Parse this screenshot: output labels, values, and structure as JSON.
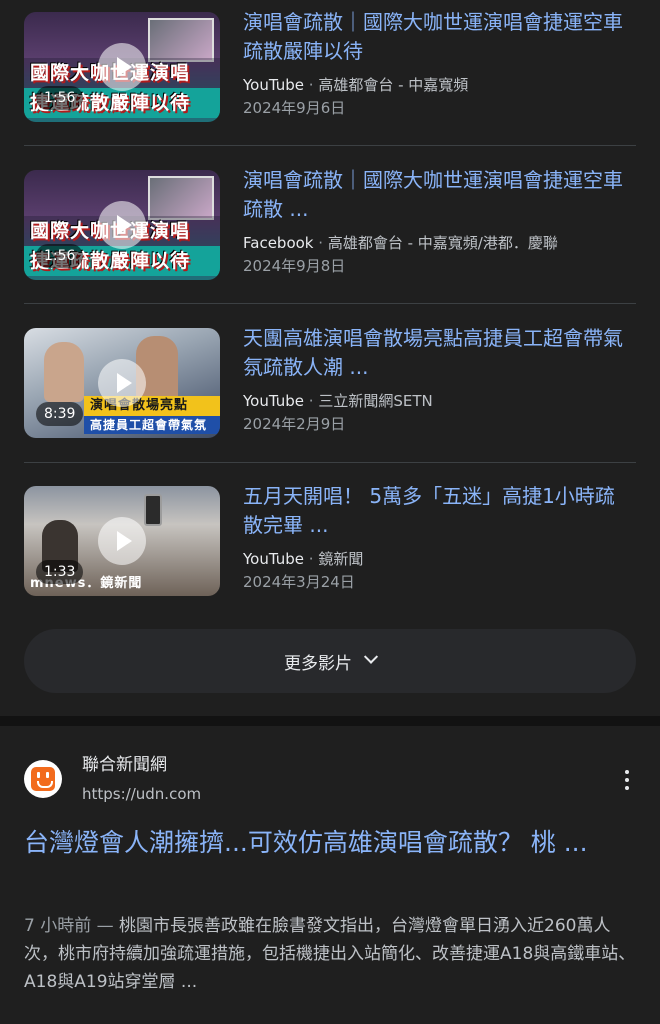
{
  "videos": [
    {
      "title": "演唱會疏散｜國際大咖世運演唱會捷運空車疏散嚴陣以待",
      "platform": "YouTube",
      "source": "高雄都會台 - 中嘉寬頻",
      "date": "2024年9月6日",
      "duration": "1:56",
      "thumb_text_1": "國際大咖世運演唱",
      "thumb_text_2": "捷運疏散嚴陣以待"
    },
    {
      "title": "演唱會疏散｜國際大咖世運演唱會捷運空車疏散 ...",
      "platform": "Facebook",
      "source": "高雄都會台 - 中嘉寬頻/港都．慶聯",
      "date": "2024年9月8日",
      "duration": "1:56",
      "thumb_text_1": "國際大咖世運演唱",
      "thumb_text_2": "捷運疏散嚴陣以待"
    },
    {
      "title": "天團高雄演唱會散場亮點高捷員工超會帶氣氛疏散人潮 ...",
      "platform": "YouTube",
      "source": "三立新聞網SETN",
      "date": "2024年2月9日",
      "duration": "8:39",
      "thumb_text_1": "演唱會散場亮點",
      "thumb_text_2": "高捷員工超會帶氣氛"
    },
    {
      "title": "五月天開唱！ 5萬多「五迷」高捷1小時疏散完畢 ...",
      "platform": "YouTube",
      "source": "鏡新聞",
      "date": "2024年3月24日",
      "duration": "1:33",
      "thumb_text_1": "mnews．鏡新聞",
      "thumb_text_2": ""
    }
  ],
  "separator": "·",
  "more_videos_label": "更多影片",
  "result": {
    "site_name": "聯合新聞網",
    "url": "https://udn.com",
    "title": "台灣燈會人潮擁擠...可效仿高雄演唱會疏散？ 桃 ...",
    "time": "7 小時前",
    "dash": " — ",
    "snippet": "桃園市長張善政雖在臉書發文指出，台灣燈會單日湧入近260萬人次，桃市府持續加強疏運措施，包括機捷出入站簡化、改善捷運A18與高鐵車站、A18與A19站穿堂層 ..."
  },
  "colors": {
    "background": "#1f1f1f",
    "link": "#8ab4f8",
    "text": "#e8eaed",
    "muted": "#9aa0a6",
    "favicon": "#f26b1d"
  },
  "icons": {
    "play": "play-icon",
    "chevron": "chevron-down-icon",
    "more": "more-vert-icon",
    "favicon": "udn-logo-icon"
  }
}
